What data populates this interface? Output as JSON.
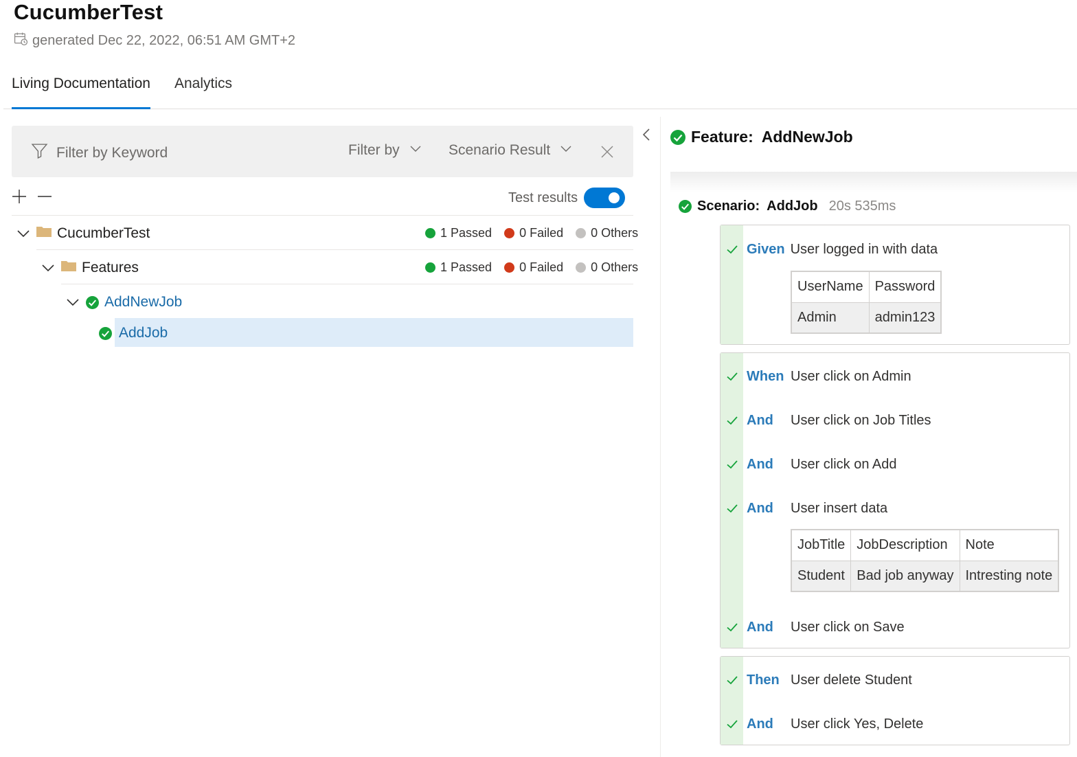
{
  "header": {
    "title": "CucumberTest",
    "generated": "generated Dec 22, 2022, 06:51 AM GMT+2"
  },
  "tabs": [
    {
      "label": "Living Documentation",
      "active": true
    },
    {
      "label": "Analytics",
      "active": false
    }
  ],
  "filter": {
    "keyword_placeholder": "Filter by Keyword",
    "filter_by_label": "Filter by",
    "scenario_result_label": "Scenario Result"
  },
  "toolbar": {
    "test_results_label": "Test results",
    "test_results_on": true
  },
  "tree": {
    "root": {
      "label": "CucumberTest",
      "passed": "1 Passed",
      "failed": "0 Failed",
      "others": "0 Others"
    },
    "features": {
      "label": "Features",
      "passed": "1 Passed",
      "failed": "0 Failed",
      "others": "0 Others"
    },
    "feature": {
      "label": "AddNewJob"
    },
    "scenario": {
      "label": "AddJob"
    }
  },
  "colors": {
    "passed": "#16a33b",
    "failed": "#d13a1a",
    "others": "#c3c1bf",
    "accent": "#0078d4"
  },
  "detail": {
    "feature_prefix": "Feature:",
    "feature_name": "AddNewJob",
    "scenario_prefix": "Scenario:",
    "scenario_name": "AddJob",
    "duration": "20s 535ms",
    "given": {
      "keyword": "Given",
      "text": "User logged in with data",
      "table": {
        "headers": [
          "UserName",
          "Password"
        ],
        "row": [
          "Admin",
          "admin123"
        ]
      }
    },
    "when_steps": [
      {
        "keyword": "When",
        "text": "User click on Admin"
      },
      {
        "keyword": "And",
        "text": "User click on Job Titles"
      },
      {
        "keyword": "And",
        "text": "User click on Add"
      },
      {
        "keyword": "And",
        "text": "User insert data"
      },
      {
        "keyword": "And",
        "text": "User click on Save"
      }
    ],
    "insert_table": {
      "headers": [
        "JobTitle",
        "JobDescription",
        "Note"
      ],
      "row": [
        "Student",
        "Bad job anyway",
        "Intresting note"
      ]
    },
    "then_steps": [
      {
        "keyword": "Then",
        "text": "User delete Student"
      },
      {
        "keyword": "And",
        "text": "User click Yes, Delete"
      }
    ]
  }
}
